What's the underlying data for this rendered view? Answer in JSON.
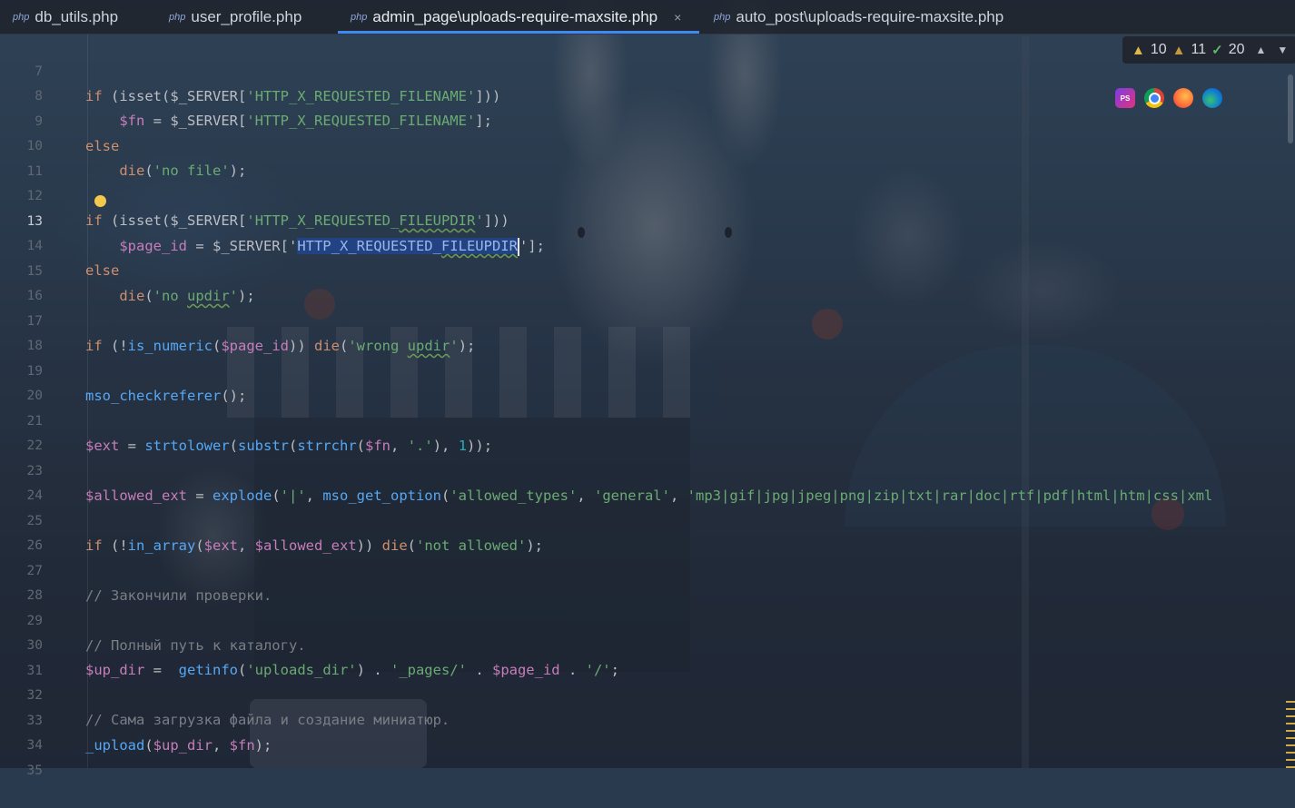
{
  "tabs": [
    {
      "badge": "php",
      "label": "db_utils.php",
      "active": false
    },
    {
      "badge": "php",
      "label": "user_profile.php",
      "active": false
    },
    {
      "badge": "php",
      "label": "admin_page\\uploads-require-maxsite.php",
      "active": true,
      "close": "×"
    },
    {
      "badge": "php",
      "label": "auto_post\\uploads-require-maxsite.php",
      "active": false
    }
  ],
  "inspections": {
    "warnings": "10",
    "weak_warnings": "11",
    "ok": "20"
  },
  "browsers": [
    "phpstorm-icon",
    "chrome-icon",
    "firefox-icon",
    "edge-icon"
  ],
  "browser_labels": {
    "phpstorm": "PS"
  },
  "current_line": "13",
  "colors": {
    "tab_accent": "#3d8af7",
    "keyword": "#cf8e6d",
    "string": "#6aab73",
    "variable": "#c77dbb",
    "function": "#56a8f5",
    "comment": "#7a7e85",
    "selection": "#214283"
  },
  "code": {
    "l7": {
      "n": "7",
      "a": "if",
      "b": " (",
      "c": "isset",
      "d": "(",
      "e": "$_SERVER",
      "f": "[",
      "g": "'HTTP_X_REQUESTED_FILENAME'",
      "h": "]))"
    },
    "l8": {
      "n": "8",
      "a": "    ",
      "b": "$fn",
      "c": " = ",
      "d": "$_SERVER",
      "e": "[",
      "f": "'HTTP_X_REQUESTED_FILENAME'",
      "g": "];"
    },
    "l9": {
      "n": "9",
      "a": "else"
    },
    "l10": {
      "n": "10",
      "a": "    ",
      "b": "die",
      "c": "(",
      "d": "'no file'",
      "e": ");"
    },
    "l11": {
      "n": "11"
    },
    "l12": {
      "n": "12",
      "a": "if",
      "b": " (",
      "c": "isset",
      "d": "(",
      "e": "$_SERVER",
      "f": "[",
      "g": "'HTTP_X_REQUESTED_",
      "h": "FILEUPDIR",
      "i": "'",
      "j": "]))"
    },
    "l13": {
      "n": "13",
      "a": "    ",
      "b": "$page_id",
      "c": " = ",
      "d": "$_SERVER",
      "e": "['",
      "f": "HTTP_X_REQUESTED_",
      "g": "FILEUPDIR",
      "h": "'];"
    },
    "l14": {
      "n": "14",
      "a": "else"
    },
    "l15": {
      "n": "15",
      "a": "    ",
      "b": "die",
      "c": "(",
      "d": "'no ",
      "e": "updir",
      "f": "'",
      "g": ");"
    },
    "l16": {
      "n": "16"
    },
    "l17": {
      "n": "17",
      "a": "if",
      "b": " (!",
      "c": "is_numeric",
      "d": "(",
      "e": "$page_id",
      "f": ")) ",
      "g": "die",
      "h": "(",
      "i": "'wrong ",
      "j": "updir",
      "k": "'",
      "l": ");"
    },
    "l18": {
      "n": "18"
    },
    "l19": {
      "n": "19",
      "a": "mso_checkreferer",
      "b": "();"
    },
    "l20": {
      "n": "20"
    },
    "l21": {
      "n": "21",
      "a": "$ext",
      "b": " = ",
      "c": "strtolower",
      "d": "(",
      "e": "substr",
      "f": "(",
      "g": "strrchr",
      "h": "(",
      "i": "$fn",
      "j": ", ",
      "k": "'.'",
      "l": "), ",
      "m": "1",
      "o": "));"
    },
    "l22": {
      "n": "22"
    },
    "l23": {
      "n": "23",
      "a": "$allowed_ext",
      "b": " = ",
      "c": "explode",
      "d": "(",
      "e": "'|'",
      "f": ", ",
      "g": "mso_get_option",
      "h": "(",
      "i": "'allowed_types'",
      "j": ", ",
      "k": "'general'",
      "l": ", ",
      "m": "'mp3|gif|jpg|jpeg|png|zip|txt|rar|doc|rtf|pdf|html|htm|css|xml"
    },
    "l24": {
      "n": "24"
    },
    "l25": {
      "n": "25",
      "a": "if",
      "b": " (!",
      "c": "in_array",
      "d": "(",
      "e": "$ext",
      "f": ", ",
      "g": "$allowed_ext",
      "h": ")) ",
      "i": "die",
      "j": "(",
      "k": "'not allowed'",
      "l": ");"
    },
    "l26": {
      "n": "26"
    },
    "l27": {
      "n": "27",
      "a": "// Закончили проверки."
    },
    "l28": {
      "n": "28"
    },
    "l29": {
      "n": "29",
      "a": "// Полный путь к каталогу."
    },
    "l30": {
      "n": "30",
      "a": "$up_dir",
      "b": " =  ",
      "c": "getinfo",
      "d": "(",
      "e": "'uploads_dir'",
      "f": ") . ",
      "g": "'_pages/'",
      "h": " . ",
      "i": "$page_id",
      "j": " . ",
      "k": "'/'",
      "l": ";"
    },
    "l31": {
      "n": "31"
    },
    "l32": {
      "n": "32",
      "a": "// Сама загрузка файла и создание миниатюр."
    },
    "l33": {
      "n": "33",
      "a": "_upload",
      "b": "(",
      "c": "$up_dir",
      "d": ", ",
      "e": "$fn",
      "f": ");"
    },
    "l34": {
      "n": "34"
    },
    "l35": {
      "n": "35"
    }
  }
}
